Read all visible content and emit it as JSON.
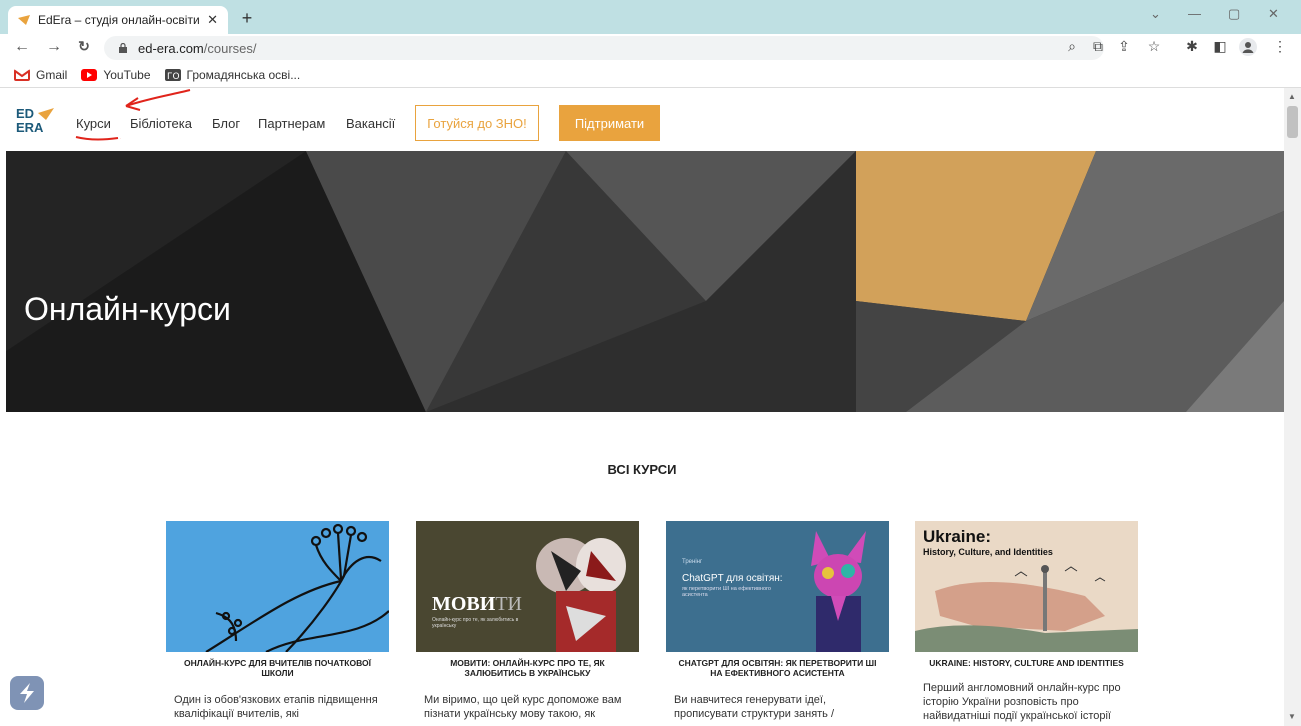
{
  "browser": {
    "tab_title": "EdEra – студія онлайн-освіти",
    "tab_close": "✕",
    "new_tab": "+",
    "url_host": "ed-era.com",
    "url_path": "/courses/",
    "bookmarks": [
      {
        "label": "Gmail",
        "color": "#d93025"
      },
      {
        "label": "YouTube",
        "color": "#ff0000"
      },
      {
        "label": "Громадянська осві...",
        "color": "#444444"
      }
    ]
  },
  "site": {
    "logo_top": "ED",
    "logo_bottom": "ERA",
    "menu": [
      "Курси",
      "Бібліотека",
      "Блог",
      "Партнерам",
      "Вакансії"
    ],
    "btn_zno": "Готуйся до ЗНО!",
    "btn_support": "Підтримати",
    "accent": "#e9a33e"
  },
  "hero": {
    "title": "Онлайн-курси"
  },
  "courses": {
    "section_title": "ВСІ КУРСИ",
    "cards": [
      {
        "title": "ОНЛАЙН-КУРС ДЛЯ ВЧИТЕЛІВ ПОЧАТКОВОЇ ШКОЛИ",
        "desc": "Один із обов'язкових етапів підвищення кваліфікації вчителів, які"
      },
      {
        "title": "МОВИТИ: ОНЛАЙН-КУРС ПРО ТЕ, ЯК ЗАЛЮБИТИСЬ В УКРАЇНСЬКУ",
        "desc": "Ми віримо, що цей курс допоможе вам пізнати українську мову такою, як",
        "img_title": "МОВИ",
        "img_title2": "ТИ",
        "img_sub": "Онлайн-курс про те, як залюбитись в українську"
      },
      {
        "title": "CHATGPT ДЛЯ ОСВІТЯН: ЯК ПЕРЕТВОРИТИ ШІ НА ЕФЕКТИВНОГО АСИСТЕНТА",
        "desc": "Ви навчитеся генерувати ідеї, прописувати структури занять /",
        "img_kicker": "Тренінг",
        "img_title": "ChatGPT для освітян:",
        "img_sub": "як перетворити ШІ на ефективного асистента"
      },
      {
        "title": "UKRAINE: HISTORY, CULTURE AND IDENTITIES",
        "desc": "Перший англомовний онлайн-курс про історію України розповість про найвидатніші події української історії",
        "img_title": "Ukraine:",
        "img_sub": "History, Culture, and Identities"
      }
    ]
  }
}
